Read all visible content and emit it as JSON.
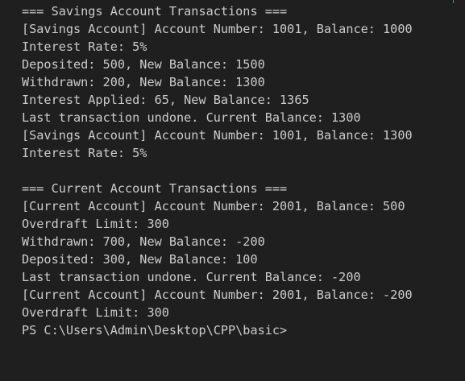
{
  "terminal": {
    "prompt": "PS C:\\Users\\Admin\\Desktop\\CPP\\basic>",
    "lines": [
      "=== Savings Account Transactions ===",
      "[Savings Account] Account Number: 1001, Balance: 1000",
      "Interest Rate: 5%",
      "Deposited: 500, New Balance: 1500",
      "Withdrawn: 200, New Balance: 1300",
      "Interest Applied: 65, New Balance: 1365",
      "Last transaction undone. Current Balance: 1300",
      "[Savings Account] Account Number: 1001, Balance: 1300",
      "Interest Rate: 5%",
      "",
      "=== Current Account Transactions ===",
      "[Current Account] Account Number: 2001, Balance: 500",
      "Overdraft Limit: 300",
      "Withdrawn: 700, New Balance: -200",
      "Deposited: 300, New Balance: 100",
      "Last transaction undone. Current Balance: -200",
      "[Current Account] Account Number: 2001, Balance: -200",
      "Overdraft Limit: 300"
    ]
  }
}
